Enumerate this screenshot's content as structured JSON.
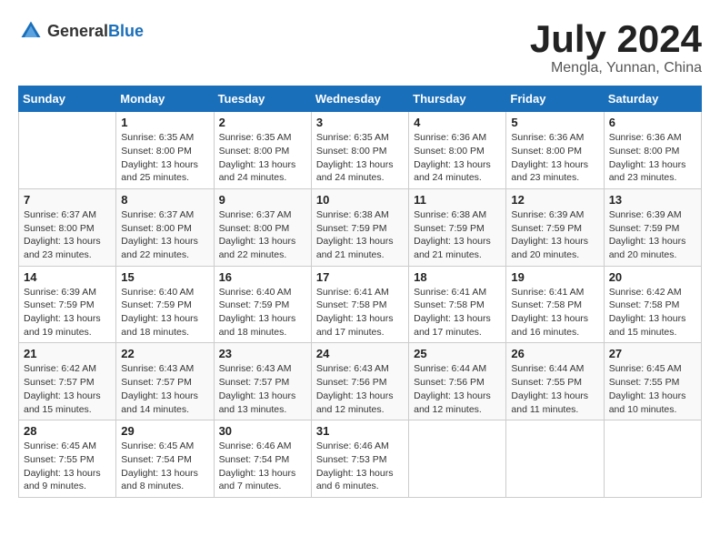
{
  "header": {
    "logo_general": "General",
    "logo_blue": "Blue",
    "month_title": "July 2024",
    "location": "Mengla, Yunnan, China"
  },
  "days_of_week": [
    "Sunday",
    "Monday",
    "Tuesday",
    "Wednesday",
    "Thursday",
    "Friday",
    "Saturday"
  ],
  "weeks": [
    [
      {
        "day": "",
        "sunrise": "",
        "sunset": "",
        "daylight": ""
      },
      {
        "day": "1",
        "sunrise": "Sunrise: 6:35 AM",
        "sunset": "Sunset: 8:00 PM",
        "daylight": "Daylight: 13 hours and 25 minutes."
      },
      {
        "day": "2",
        "sunrise": "Sunrise: 6:35 AM",
        "sunset": "Sunset: 8:00 PM",
        "daylight": "Daylight: 13 hours and 24 minutes."
      },
      {
        "day": "3",
        "sunrise": "Sunrise: 6:35 AM",
        "sunset": "Sunset: 8:00 PM",
        "daylight": "Daylight: 13 hours and 24 minutes."
      },
      {
        "day": "4",
        "sunrise": "Sunrise: 6:36 AM",
        "sunset": "Sunset: 8:00 PM",
        "daylight": "Daylight: 13 hours and 24 minutes."
      },
      {
        "day": "5",
        "sunrise": "Sunrise: 6:36 AM",
        "sunset": "Sunset: 8:00 PM",
        "daylight": "Daylight: 13 hours and 23 minutes."
      },
      {
        "day": "6",
        "sunrise": "Sunrise: 6:36 AM",
        "sunset": "Sunset: 8:00 PM",
        "daylight": "Daylight: 13 hours and 23 minutes."
      }
    ],
    [
      {
        "day": "7",
        "sunrise": "Sunrise: 6:37 AM",
        "sunset": "Sunset: 8:00 PM",
        "daylight": "Daylight: 13 hours and 23 minutes."
      },
      {
        "day": "8",
        "sunrise": "Sunrise: 6:37 AM",
        "sunset": "Sunset: 8:00 PM",
        "daylight": "Daylight: 13 hours and 22 minutes."
      },
      {
        "day": "9",
        "sunrise": "Sunrise: 6:37 AM",
        "sunset": "Sunset: 8:00 PM",
        "daylight": "Daylight: 13 hours and 22 minutes."
      },
      {
        "day": "10",
        "sunrise": "Sunrise: 6:38 AM",
        "sunset": "Sunset: 7:59 PM",
        "daylight": "Daylight: 13 hours and 21 minutes."
      },
      {
        "day": "11",
        "sunrise": "Sunrise: 6:38 AM",
        "sunset": "Sunset: 7:59 PM",
        "daylight": "Daylight: 13 hours and 21 minutes."
      },
      {
        "day": "12",
        "sunrise": "Sunrise: 6:39 AM",
        "sunset": "Sunset: 7:59 PM",
        "daylight": "Daylight: 13 hours and 20 minutes."
      },
      {
        "day": "13",
        "sunrise": "Sunrise: 6:39 AM",
        "sunset": "Sunset: 7:59 PM",
        "daylight": "Daylight: 13 hours and 20 minutes."
      }
    ],
    [
      {
        "day": "14",
        "sunrise": "Sunrise: 6:39 AM",
        "sunset": "Sunset: 7:59 PM",
        "daylight": "Daylight: 13 hours and 19 minutes."
      },
      {
        "day": "15",
        "sunrise": "Sunrise: 6:40 AM",
        "sunset": "Sunset: 7:59 PM",
        "daylight": "Daylight: 13 hours and 18 minutes."
      },
      {
        "day": "16",
        "sunrise": "Sunrise: 6:40 AM",
        "sunset": "Sunset: 7:59 PM",
        "daylight": "Daylight: 13 hours and 18 minutes."
      },
      {
        "day": "17",
        "sunrise": "Sunrise: 6:41 AM",
        "sunset": "Sunset: 7:58 PM",
        "daylight": "Daylight: 13 hours and 17 minutes."
      },
      {
        "day": "18",
        "sunrise": "Sunrise: 6:41 AM",
        "sunset": "Sunset: 7:58 PM",
        "daylight": "Daylight: 13 hours and 17 minutes."
      },
      {
        "day": "19",
        "sunrise": "Sunrise: 6:41 AM",
        "sunset": "Sunset: 7:58 PM",
        "daylight": "Daylight: 13 hours and 16 minutes."
      },
      {
        "day": "20",
        "sunrise": "Sunrise: 6:42 AM",
        "sunset": "Sunset: 7:58 PM",
        "daylight": "Daylight: 13 hours and 15 minutes."
      }
    ],
    [
      {
        "day": "21",
        "sunrise": "Sunrise: 6:42 AM",
        "sunset": "Sunset: 7:57 PM",
        "daylight": "Daylight: 13 hours and 15 minutes."
      },
      {
        "day": "22",
        "sunrise": "Sunrise: 6:43 AM",
        "sunset": "Sunset: 7:57 PM",
        "daylight": "Daylight: 13 hours and 14 minutes."
      },
      {
        "day": "23",
        "sunrise": "Sunrise: 6:43 AM",
        "sunset": "Sunset: 7:57 PM",
        "daylight": "Daylight: 13 hours and 13 minutes."
      },
      {
        "day": "24",
        "sunrise": "Sunrise: 6:43 AM",
        "sunset": "Sunset: 7:56 PM",
        "daylight": "Daylight: 13 hours and 12 minutes."
      },
      {
        "day": "25",
        "sunrise": "Sunrise: 6:44 AM",
        "sunset": "Sunset: 7:56 PM",
        "daylight": "Daylight: 13 hours and 12 minutes."
      },
      {
        "day": "26",
        "sunrise": "Sunrise: 6:44 AM",
        "sunset": "Sunset: 7:55 PM",
        "daylight": "Daylight: 13 hours and 11 minutes."
      },
      {
        "day": "27",
        "sunrise": "Sunrise: 6:45 AM",
        "sunset": "Sunset: 7:55 PM",
        "daylight": "Daylight: 13 hours and 10 minutes."
      }
    ],
    [
      {
        "day": "28",
        "sunrise": "Sunrise: 6:45 AM",
        "sunset": "Sunset: 7:55 PM",
        "daylight": "Daylight: 13 hours and 9 minutes."
      },
      {
        "day": "29",
        "sunrise": "Sunrise: 6:45 AM",
        "sunset": "Sunset: 7:54 PM",
        "daylight": "Daylight: 13 hours and 8 minutes."
      },
      {
        "day": "30",
        "sunrise": "Sunrise: 6:46 AM",
        "sunset": "Sunset: 7:54 PM",
        "daylight": "Daylight: 13 hours and 7 minutes."
      },
      {
        "day": "31",
        "sunrise": "Sunrise: 6:46 AM",
        "sunset": "Sunset: 7:53 PM",
        "daylight": "Daylight: 13 hours and 6 minutes."
      },
      {
        "day": "",
        "sunrise": "",
        "sunset": "",
        "daylight": ""
      },
      {
        "day": "",
        "sunrise": "",
        "sunset": "",
        "daylight": ""
      },
      {
        "day": "",
        "sunrise": "",
        "sunset": "",
        "daylight": ""
      }
    ]
  ]
}
